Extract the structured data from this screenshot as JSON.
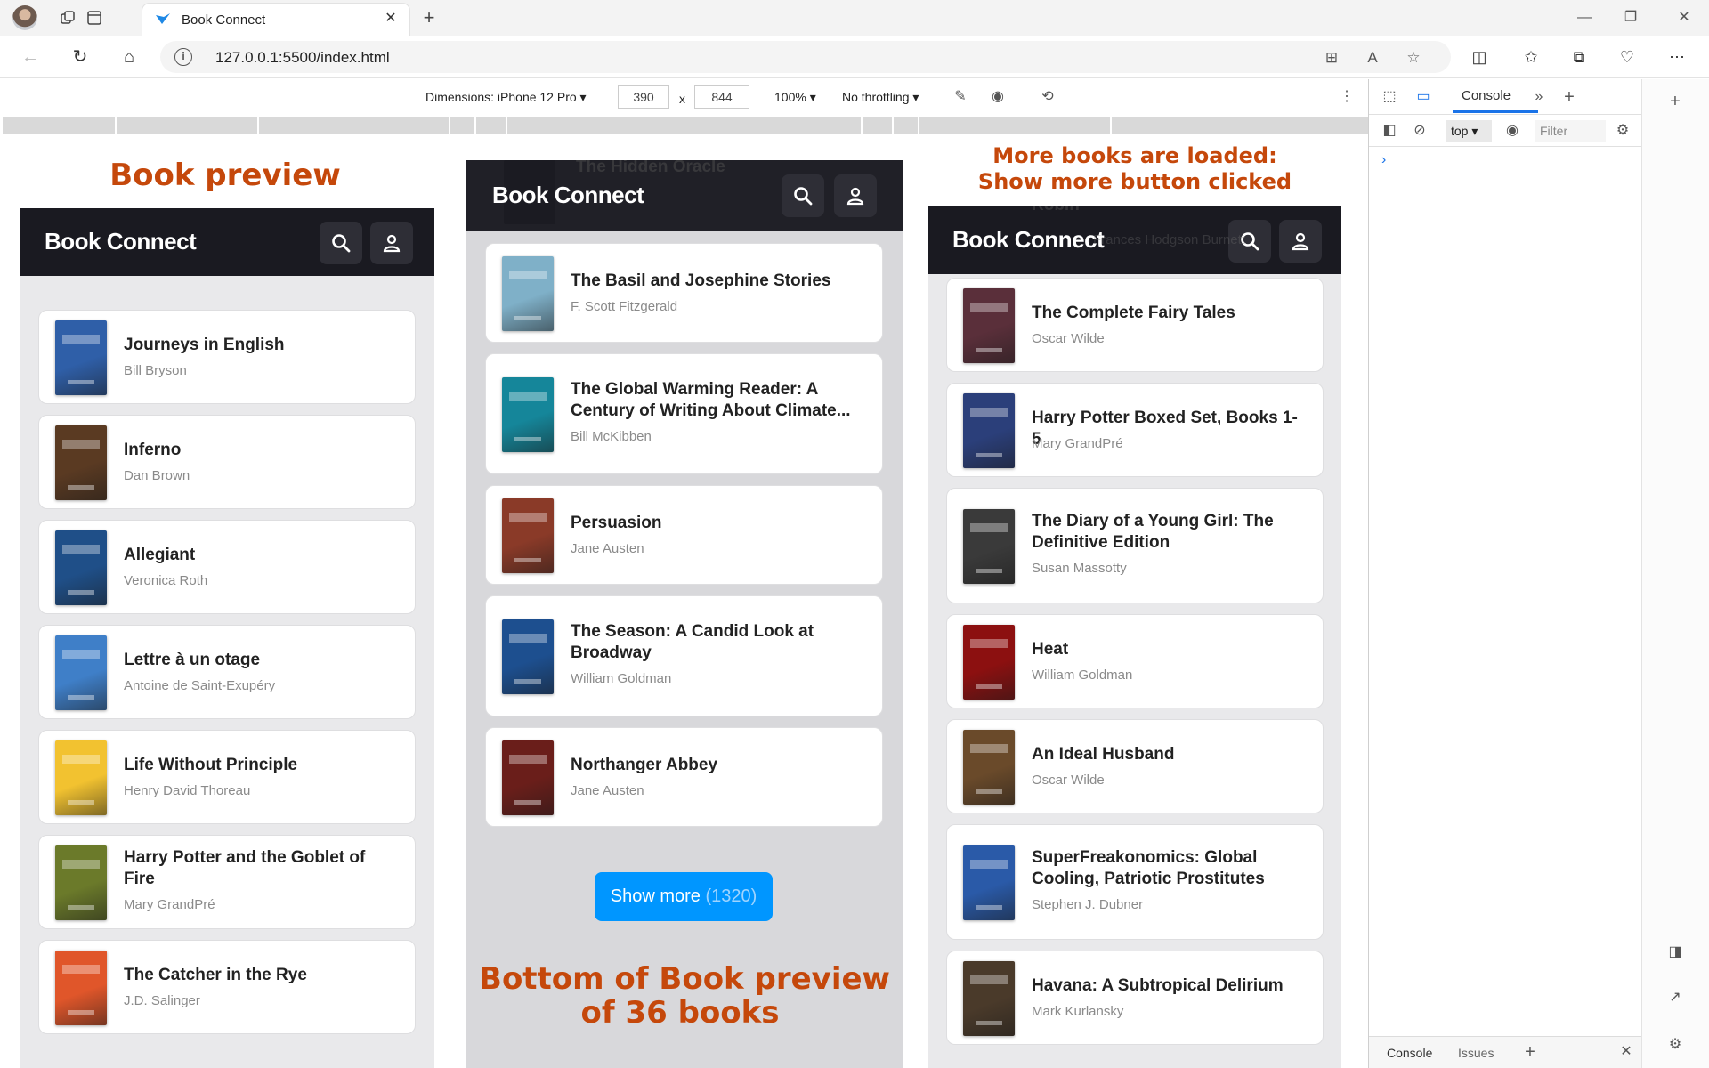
{
  "browser": {
    "tab_title": "Book Connect",
    "url": "127.0.0.1:5500/index.html"
  },
  "device_toolbar": {
    "dimensions_label": "Dimensions: iPhone 12 Pro",
    "width": "390",
    "separator": "x",
    "height": "844",
    "zoom": "100%",
    "throttling": "No throttling"
  },
  "labels": {
    "left": "Book preview",
    "right_line1": "More books are loaded:",
    "right_line2": "Show more button clicked",
    "middle_line1": "Bottom of Book preview",
    "middle_line2": "of 36 books"
  },
  "app": {
    "logo": "Book Connect",
    "show_more_label": "Show more",
    "show_more_count": "(1320)"
  },
  "left_books": [
    {
      "title": "Journeys in English",
      "author": "Bill Bryson",
      "color": "#2f5fa8"
    },
    {
      "title": "Inferno",
      "author": "Dan Brown",
      "color": "#5a3a22"
    },
    {
      "title": "Allegiant",
      "author": "Veronica Roth",
      "color": "#1f4f88"
    },
    {
      "title": "Lettre à un otage",
      "author": "Antoine de Saint-Exupéry",
      "color": "#3f7fc8"
    },
    {
      "title": "Life Without Principle",
      "author": "Henry David Thoreau",
      "color": "#f2c230"
    },
    {
      "title": "Harry Potter and the Goblet of Fire",
      "author": "Mary GrandPré",
      "color": "#6b7a2a"
    },
    {
      "title": "The Catcher in the Rye",
      "author": "J.D. Salinger",
      "color": "#e0562a"
    }
  ],
  "middle_ghost": {
    "title": "The Hidden Oracle"
  },
  "middle_books": [
    {
      "title": "The Basil and Josephine Stories",
      "author": "F. Scott Fitzgerald",
      "color": "#7fb0c8"
    },
    {
      "title": "The Global Warming Reader: A Century of Writing About Climate...",
      "author": "Bill McKibben",
      "color": "#15869a"
    },
    {
      "title": "Persuasion",
      "author": "Jane Austen",
      "color": "#8a3a28"
    },
    {
      "title": "The Season: A Candid Look at Broadway",
      "author": "William Goldman",
      "color": "#1d4f8f"
    },
    {
      "title": "Northanger Abbey",
      "author": "Jane Austen",
      "color": "#6a1e1a"
    }
  ],
  "right_ghost": {
    "title": "Robin",
    "author": "Frances Hodgson Burnett"
  },
  "right_books": [
    {
      "title": "The Complete Fairy Tales",
      "author": "Oscar Wilde",
      "color": "#5a2f3a"
    },
    {
      "title": "Harry Potter Boxed Set, Books 1-5",
      "author": "Mary GrandPré",
      "color": "#2b3f7a"
    },
    {
      "title": "The Diary of a Young Girl: The Definitive Edition",
      "author": "Susan Massotty",
      "color": "#3a3a3a"
    },
    {
      "title": "Heat",
      "author": "William Goldman",
      "color": "#8c1010"
    },
    {
      "title": "An Ideal Husband",
      "author": "Oscar Wilde",
      "color": "#6a4a2a"
    },
    {
      "title": "SuperFreakonomics: Global Cooling, Patriotic Prostitutes And...",
      "author": "Stephen J. Dubner",
      "color": "#2a5aa8"
    },
    {
      "title": "Havana: A Subtropical Delirium",
      "author": "Mark Kurlansky",
      "color": "#4a3a2a"
    }
  ],
  "devtools": {
    "tab_console": "Console",
    "context": "top",
    "filter_placeholder": "Filter",
    "prompt": "›",
    "bottom_console": "Console",
    "bottom_issues": "Issues"
  }
}
